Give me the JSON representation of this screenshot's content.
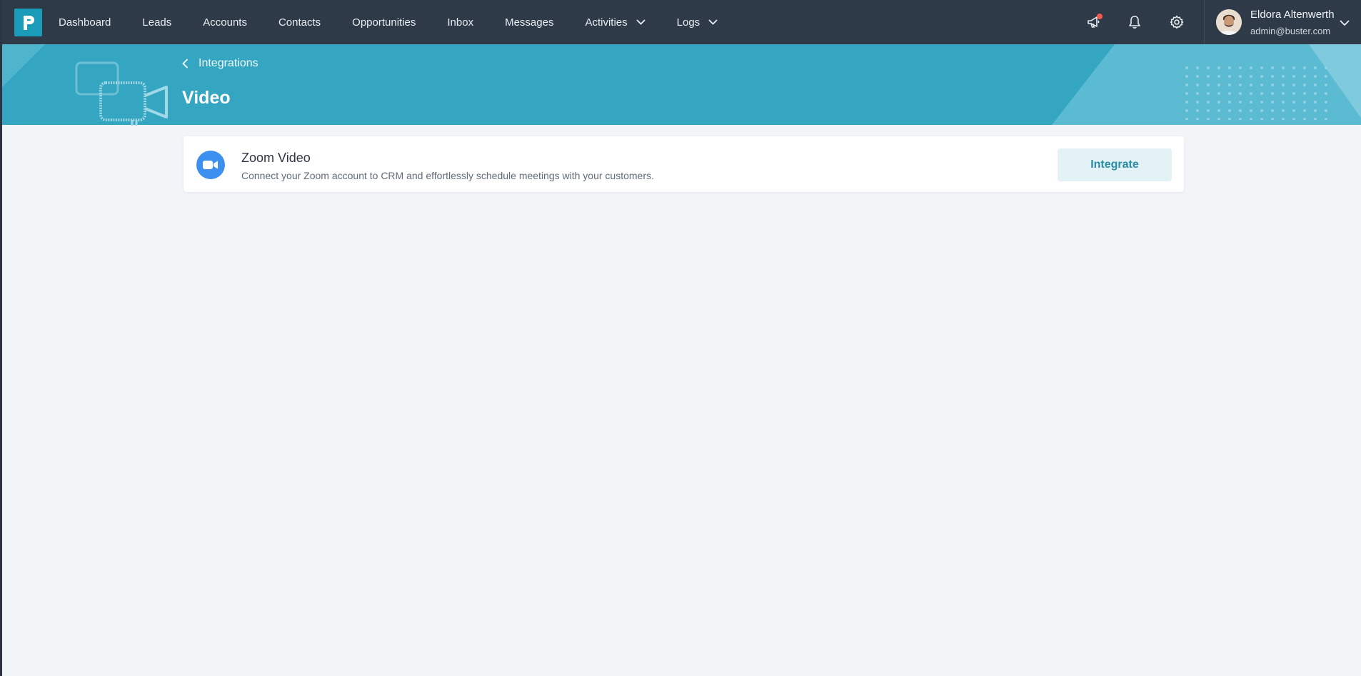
{
  "nav": {
    "items": [
      {
        "label": "Dashboard"
      },
      {
        "label": "Leads"
      },
      {
        "label": "Accounts"
      },
      {
        "label": "Contacts"
      },
      {
        "label": "Opportunities"
      },
      {
        "label": "Inbox"
      },
      {
        "label": "Messages"
      },
      {
        "label": "Activities",
        "has_dropdown": true
      },
      {
        "label": "Logs",
        "has_dropdown": true
      }
    ]
  },
  "header_icons": [
    "megaphone-icon",
    "bell-icon",
    "gear-icon"
  ],
  "user": {
    "name": "Eldora Altenwerth",
    "email": "admin@buster.com"
  },
  "banner": {
    "back_label": "Integrations",
    "title": "Video"
  },
  "integrations": [
    {
      "icon": "video-camera-icon",
      "name": "Zoom Video",
      "description": "Connect your Zoom account to CRM and effortlessly schedule meetings with your customers.",
      "action_label": "Integrate"
    }
  ],
  "colors": {
    "topbar": "#2f3a48",
    "banner": "#35a6c2",
    "accent": "#1a9bb8",
    "zoom": "#3d8ff0",
    "notification": "#f05a4f"
  }
}
